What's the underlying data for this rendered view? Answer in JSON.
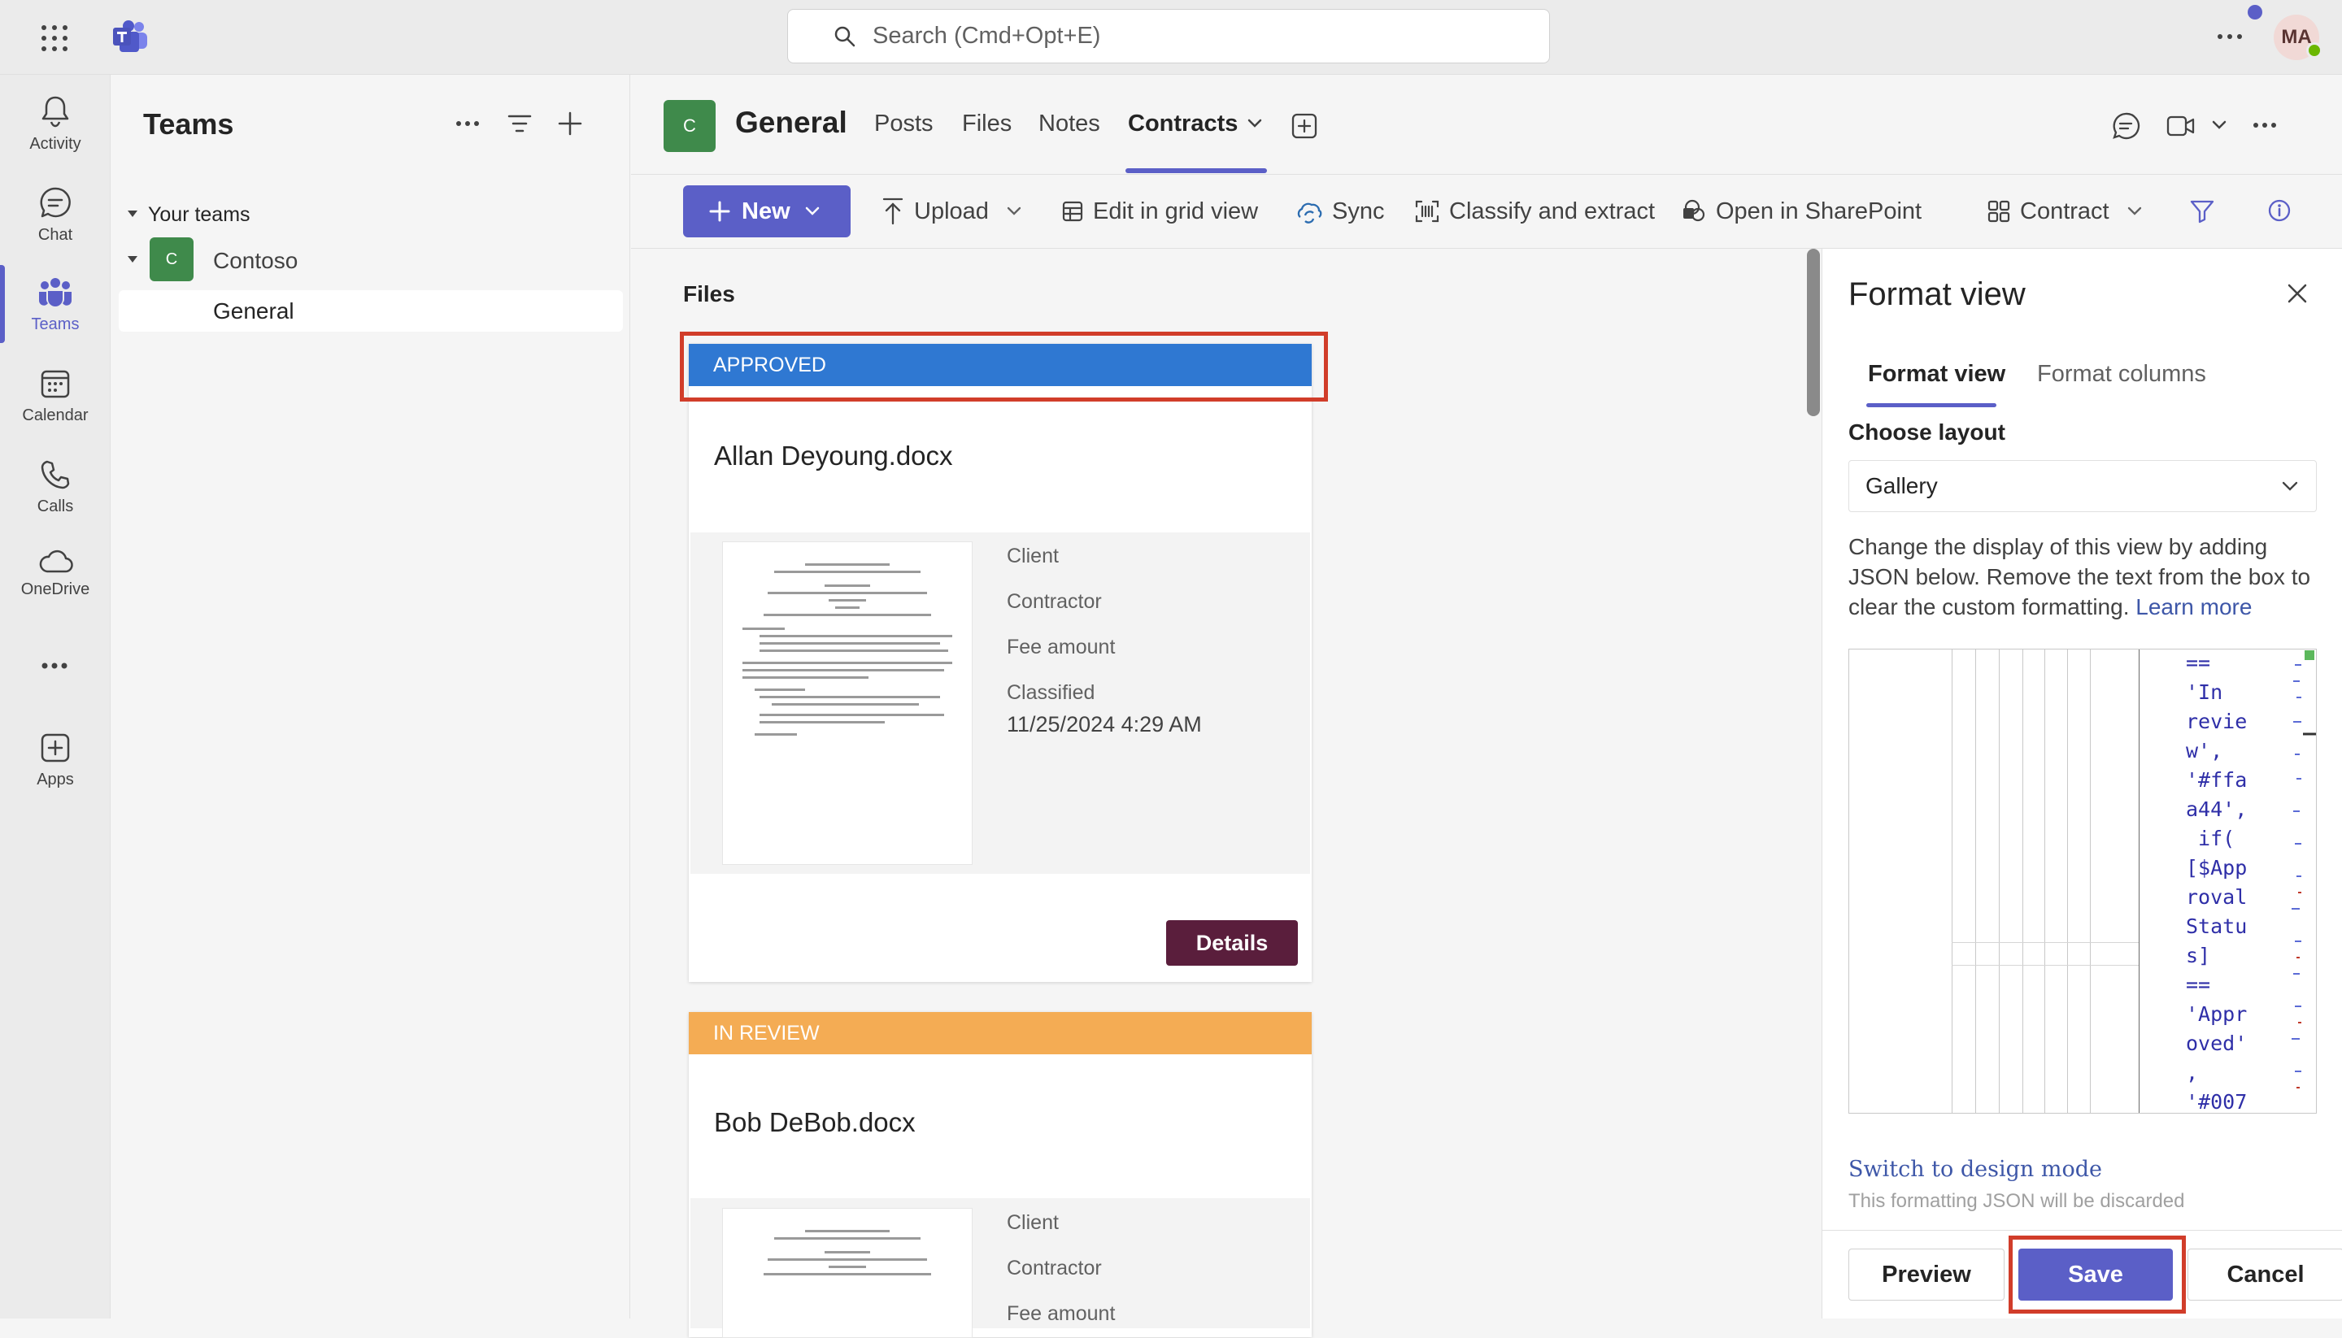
{
  "topbar": {
    "search_placeholder": "Search (Cmd+Opt+E)",
    "avatar_initials": "MA"
  },
  "rail": {
    "items": [
      {
        "label": "Activity",
        "icon": "bell-icon"
      },
      {
        "label": "Chat",
        "icon": "chat-icon"
      },
      {
        "label": "Teams",
        "icon": "teams-icon"
      },
      {
        "label": "Calendar",
        "icon": "calendar-icon"
      },
      {
        "label": "Calls",
        "icon": "phone-icon"
      },
      {
        "label": "OneDrive",
        "icon": "cloud-icon"
      },
      {
        "label": "Apps",
        "icon": "add-app-icon"
      }
    ]
  },
  "teams_pane": {
    "title": "Teams",
    "section": "Your teams",
    "team": {
      "initial": "C",
      "name": "Contoso"
    },
    "channel": "General"
  },
  "channel": {
    "initial": "C",
    "title": "General",
    "tabs": [
      "Posts",
      "Files",
      "Notes",
      "Contracts"
    ],
    "active_tab": "Contracts"
  },
  "toolbar": {
    "new": "New",
    "upload": "Upload",
    "edit_grid": "Edit in grid view",
    "sync": "Sync",
    "classify": "Classify and extract",
    "open_sharepoint": "Open in SharePoint",
    "view": "Contract"
  },
  "files": {
    "title": "Files",
    "cards": [
      {
        "status": "APPROVED",
        "status_color": "#2f78d2",
        "name": "Allan Deyoung.docx",
        "fields": [
          {
            "label": "Client",
            "value": ""
          },
          {
            "label": "Contractor",
            "value": ""
          },
          {
            "label": "Fee amount",
            "value": ""
          },
          {
            "label": "Classified",
            "value": "11/25/2024 4:29 AM"
          }
        ],
        "action": "Details"
      },
      {
        "status": "IN REVIEW",
        "status_color": "#f4ac54",
        "name": "Bob DeBob.docx",
        "fields": [
          {
            "label": "Client"
          },
          {
            "label": "Contractor"
          },
          {
            "label": "Fee amount"
          }
        ]
      }
    ]
  },
  "format_panel": {
    "title": "Format view",
    "tabs": [
      "Format view",
      "Format columns"
    ],
    "choose_layout_label": "Choose layout",
    "layout_value": "Gallery",
    "description": "Change the display of this view by adding JSON below. Remove the text from the box to clear the custom formatting.",
    "learn_more": "Learn more",
    "json_lines": [
      "==",
      "'In",
      "revie",
      "w',",
      "'#ffa",
      "a44',",
      " if(",
      "[$App",
      "roval",
      "Statu",
      "s]",
      "==",
      "'Appr",
      "oved'",
      ",",
      "'#007"
    ],
    "switch_link": "Switch to design mode",
    "switch_note": "This formatting JSON will be discarded",
    "buttons": {
      "preview": "Preview",
      "save": "Save",
      "cancel": "Cancel"
    }
  },
  "colors": {
    "accent": "#5b5fc7",
    "approved": "#2f78d2",
    "in_review": "#f4ac54",
    "details_button": "#5a1e3c",
    "highlight_box": "#d13d2a"
  }
}
